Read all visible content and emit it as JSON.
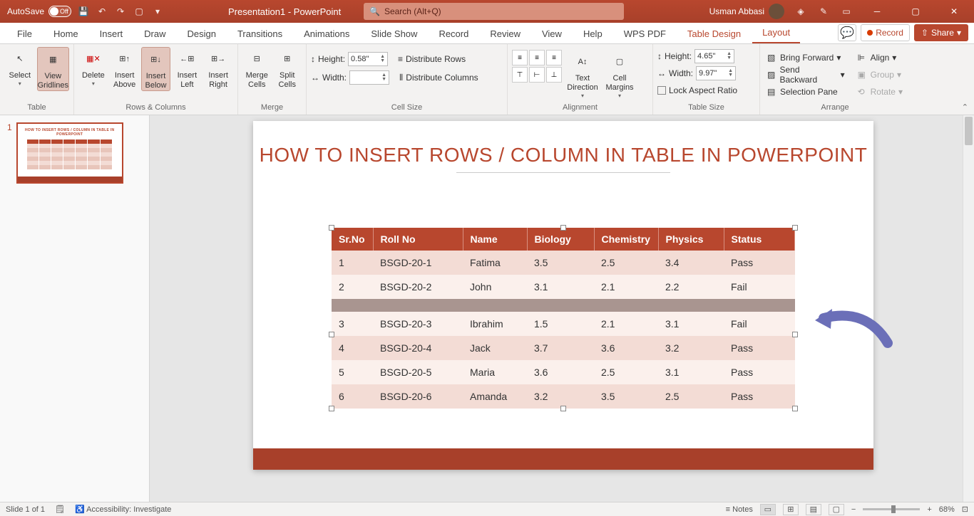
{
  "titleBar": {
    "autosave": "AutoSave",
    "autosaveState": "Off",
    "docTitle": "Presentation1 - PowerPoint",
    "searchPlaceholder": "Search (Alt+Q)",
    "userName": "Usman Abbasi"
  },
  "tabs": {
    "file": "File",
    "home": "Home",
    "insert": "Insert",
    "draw": "Draw",
    "design": "Design",
    "transitions": "Transitions",
    "animations": "Animations",
    "slideShow": "Slide Show",
    "record": "Record",
    "review": "Review",
    "view": "View",
    "help": "Help",
    "wps": "WPS PDF",
    "tableDesign": "Table Design",
    "layout": "Layout",
    "recordBtn": "Record",
    "shareBtn": "Share"
  },
  "ribbon": {
    "table": {
      "select": "Select",
      "viewGridlines_l1": "View",
      "viewGridlines_l2": "Gridlines",
      "delete": "Delete",
      "group": "Table"
    },
    "rowsCols": {
      "insertAbove_l1": "Insert",
      "insertAbove_l2": "Above",
      "insertBelow_l1": "Insert",
      "insertBelow_l2": "Below",
      "insertLeft_l1": "Insert",
      "insertLeft_l2": "Left",
      "insertRight_l1": "Insert",
      "insertRight_l2": "Right",
      "group": "Rows & Columns"
    },
    "merge": {
      "mergeCells_l1": "Merge",
      "mergeCells_l2": "Cells",
      "splitCells_l1": "Split",
      "splitCells_l2": "Cells",
      "group": "Merge"
    },
    "cellSize": {
      "heightLabel": "Height:",
      "heightVal": "0.58\"",
      "widthLabel": "Width:",
      "widthVal": "",
      "distRows": "Distribute Rows",
      "distCols": "Distribute Columns",
      "group": "Cell Size"
    },
    "alignment": {
      "textDir_l1": "Text",
      "textDir_l2": "Direction",
      "cellMargins_l1": "Cell",
      "cellMargins_l2": "Margins",
      "group": "Alignment"
    },
    "tableSize": {
      "heightLabel": "Height:",
      "heightVal": "4.65\"",
      "widthLabel": "Width:",
      "widthVal": "9.97\"",
      "lockAspect": "Lock Aspect Ratio",
      "group": "Table Size"
    },
    "arrange": {
      "bringForward": "Bring Forward",
      "sendBackward": "Send Backward",
      "selectionPane": "Selection Pane",
      "align": "Align",
      "groupObj": "Group",
      "rotate": "Rotate",
      "groupLabel": "Arrange"
    }
  },
  "thumbPanel": {
    "num": "1",
    "miniTitle": "HOW TO INSERT ROWS / COLUMN IN TABLE IN POWERPOINT"
  },
  "slide": {
    "title": "HOW TO INSERT ROWS / COLUMN IN TABLE IN POWERPOINT",
    "headers": {
      "srno": "Sr.No",
      "roll": "Roll No",
      "name": "Name",
      "bio": "Biology",
      "chem": "Chemistry",
      "phys": "Physics",
      "status": "Status"
    },
    "rows": [
      {
        "sr": "1",
        "roll": "BSGD-20-1",
        "name": "Fatima",
        "bio": "3.5",
        "chem": "2.5",
        "phys": "3.4",
        "status": "Pass"
      },
      {
        "sr": "2",
        "roll": "BSGD-20-2",
        "name": "John",
        "bio": "3.1",
        "chem": "2.1",
        "phys": "2.2",
        "status": "Fail"
      },
      {
        "sr": "",
        "roll": "",
        "name": "",
        "bio": "",
        "chem": "",
        "phys": "",
        "status": ""
      },
      {
        "sr": "3",
        "roll": "BSGD-20-3",
        "name": "Ibrahim",
        "bio": "1.5",
        "chem": "2.1",
        "phys": "3.1",
        "status": "Fail"
      },
      {
        "sr": "4",
        "roll": "BSGD-20-4",
        "name": "Jack",
        "bio": "3.7",
        "chem": "3.6",
        "phys": "3.2",
        "status": "Pass"
      },
      {
        "sr": "5",
        "roll": "BSGD-20-5",
        "name": "Maria",
        "bio": "3.6",
        "chem": "2.5",
        "phys": "3.1",
        "status": "Pass"
      },
      {
        "sr": "6",
        "roll": "BSGD-20-6",
        "name": "Amanda",
        "bio": "3.2",
        "chem": "3.5",
        "phys": "2.5",
        "status": "Pass"
      }
    ]
  },
  "status": {
    "slideCount": "Slide 1 of 1",
    "accessibility": "Accessibility: Investigate",
    "notes": "Notes",
    "zoom": "68%"
  }
}
